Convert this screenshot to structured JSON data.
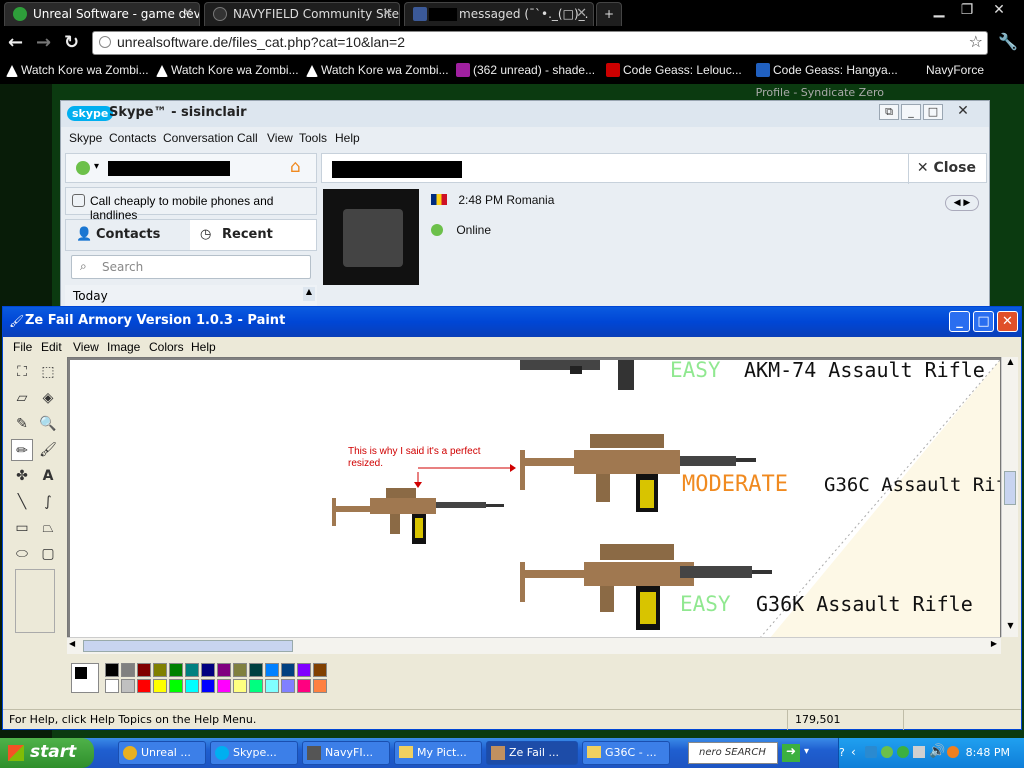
{
  "chrome": {
    "tabs": [
      {
        "title": "Unreal Software - game dev a"
      },
      {
        "title": "NAVYFIELD Community Site"
      },
      {
        "title": "messaged (¯`•._(□)_."
      }
    ],
    "url": "unrealsoftware.de/files_cat.php?cat=10&lan=2",
    "bookmarks": [
      "Watch Kore wa Zombi...",
      "Watch Kore wa Zombi...",
      "Watch Kore wa Zombi...",
      "(362 unread) - shade...",
      "Code Geass: Lelouc...",
      "Code Geass: Hangya...",
      "NavyForce"
    ],
    "page_profile": "Profile - Syndicate Zero"
  },
  "skype": {
    "title": "Skype™ - sisinclair",
    "logo": "skype",
    "menu": [
      "Skype",
      "Contacts",
      "Conversation",
      "Call",
      "View",
      "Tools",
      "Help"
    ],
    "call_cheap": "Call cheaply to mobile phones and landlines",
    "tab_contacts": "Contacts",
    "tab_recent": "Recent",
    "search_placeholder": "Search",
    "today": "Today",
    "close_label": "Close",
    "time_location": "2:48 PM Romania",
    "status": "Online"
  },
  "paint": {
    "title": "Ze Fail Armory Version 1.0.3 - Paint",
    "menu": [
      "File",
      "Edit",
      "View",
      "Image",
      "Colors",
      "Help"
    ],
    "status_help": "For Help, click Help Topics on the Help Menu.",
    "coords": "179,501",
    "annotation_line1": "This is why I said it's a perfect",
    "annotation_line2": "resized.",
    "rows": [
      {
        "difficulty": "EASY",
        "name": "AKM-74 Assault Rifle",
        "color": "#90e890"
      },
      {
        "difficulty": "MODERATE",
        "name": "G36C Assault Rifle",
        "color": "#f08a20"
      },
      {
        "difficulty": "EASY",
        "name": "G36K Assault Rifle",
        "color": "#90e890"
      }
    ],
    "palette": [
      "#000000",
      "#808080",
      "#800000",
      "#808000",
      "#008000",
      "#008080",
      "#000080",
      "#800080",
      "#808040",
      "#004040",
      "#0080ff",
      "#004080",
      "#8000ff",
      "#804000",
      "#ffffff",
      "#c0c0c0",
      "#ff0000",
      "#ffff00",
      "#00ff00",
      "#00ffff",
      "#0000ff",
      "#ff00ff",
      "#ffff80",
      "#00ff80",
      "#80ffff",
      "#8080ff",
      "#ff0080",
      "#ff8040"
    ]
  },
  "taskbar": {
    "start": "start",
    "tasks": [
      "Unreal ...",
      "Skype...",
      "NavyFI...",
      "My Pict...",
      "Ze Fail ...",
      "G36C - ..."
    ],
    "search_brand": "nero SEARCH",
    "clock": "8:48 PM"
  }
}
